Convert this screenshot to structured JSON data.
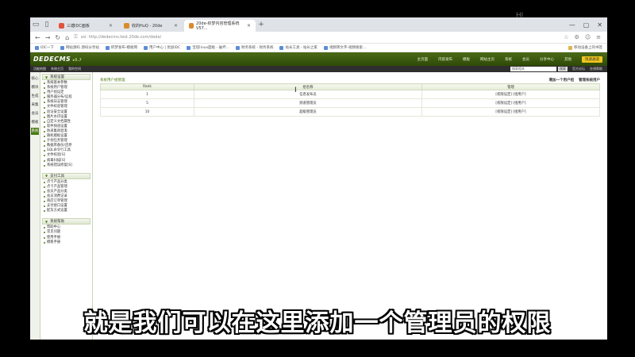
{
  "browser": {
    "tabs": [
      {
        "label": "三塘IDC面板",
        "active": false
      },
      {
        "label": "收的HuQ - 20de",
        "active": false
      },
      {
        "label": "20de-织梦内容管理系统 V57...",
        "active": true
      }
    ],
    "url": "ssl: http://dedecms.test.20de.com/dede/",
    "bookmarks": [
      "IDC一下",
      "网站源码 源码分享站",
      "织梦发布-模板网",
      "用户中心 | 优加IDC",
      "宝塔linux面板 - 破坏...",
      "财务系统 - 财务系统",
      "站长工具 - 站长之家",
      "视频转文字-视频搜索..."
    ],
    "bookmarks_right": "移动设备上的书签"
  },
  "dede": {
    "logo": "DEDECMS",
    "logo_ver": "v5.7",
    "topnav": [
      "主页面",
      "内容发布",
      "模板",
      "网站主页",
      "系统",
      "会员",
      "分享中心",
      "其他"
    ],
    "topnav_selected": "快速通道",
    "subbar_left": [
      "功能地图",
      "系统主页",
      "我的空间"
    ],
    "search_placeholder": "搜索相关",
    "search_btn": "搜索",
    "subbar_links": [
      "官方论坛",
      "在线帮助"
    ]
  },
  "vtabs": [
    "核心",
    "模块",
    "生成",
    "采集",
    "会员",
    "模板",
    "系统"
  ],
  "vtabs_active": "系统",
  "menu": [
    {
      "title": "系统设置",
      "items": [
        "系统基本参数",
        "系统用户管理",
        "用户组设定",
        "服务器分布/远程",
        "系统日志管理",
        "文件校验管理",
        "验证安全设置",
        "图片水印设置",
        "自定义文档属性",
        "软件频道设置",
        "防采集串混淆",
        "随机模板设置",
        "计划任务管理",
        "数据库备份/还原",
        "SQL命令行工具",
        "文件校验[S]",
        "病毒扫描[S]",
        "系统错误修复[S]"
      ]
    },
    {
      "title": "支付工具",
      "items": [
        "点卡产品分类",
        "点卡产品管理",
        "会员产品分类",
        "会员消费记录",
        "商店订单管理",
        "支付接口设置",
        "配货方式设置"
      ]
    },
    {
      "title": "系统帮助",
      "items": [
        "帮助中心",
        "常见问题",
        "使用手册",
        "模板手册"
      ]
    }
  ],
  "main": {
    "title": "系统用户组管理",
    "links": [
      "增加一个用户组",
      "管理系统用户"
    ],
    "columns": [
      "Rank",
      "组名称",
      "管理"
    ],
    "rows": [
      {
        "rank": "1",
        "name": "信息发布员",
        "action": "[权限设定] [组用户]"
      },
      {
        "rank": "5",
        "name": "频道管理员",
        "action": "[权限设定] [组用户]"
      },
      {
        "rank": "10",
        "name": "超级管理员",
        "action": "[权限设定] [组用户]"
      }
    ]
  },
  "subtitle": "就是我们可以在这里添加一个管理员的权限"
}
